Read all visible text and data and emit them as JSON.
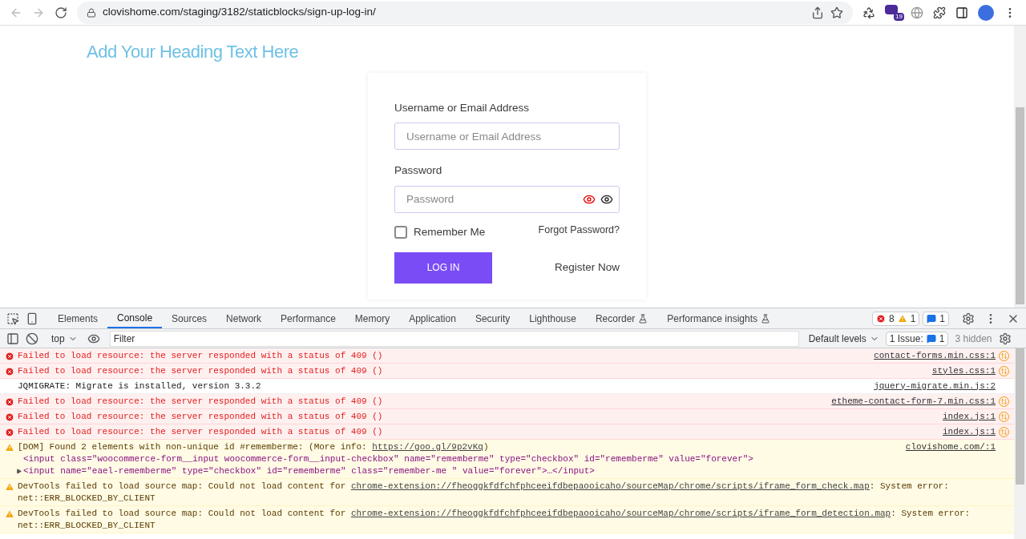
{
  "browser": {
    "url": "clovishome.com/staging/3182/staticblocks/sign-up-log-in/",
    "extension_badge": "19"
  },
  "page": {
    "heading": "Add Your Heading Text Here",
    "form": {
      "username_label": "Username or Email Address",
      "username_placeholder": "Username or Email Address",
      "password_label": "Password",
      "password_placeholder": "Password",
      "remember_label": "Remember Me",
      "remember_checked": false,
      "forgot_link": "Forgot Password?",
      "login_button": "LOG IN",
      "register_link": "Register Now"
    }
  },
  "devtools": {
    "tabs": [
      {
        "label": "Elements",
        "selected": false,
        "experimental": false
      },
      {
        "label": "Console",
        "selected": true,
        "experimental": false
      },
      {
        "label": "Sources",
        "selected": false,
        "experimental": false
      },
      {
        "label": "Network",
        "selected": false,
        "experimental": false
      },
      {
        "label": "Performance",
        "selected": false,
        "experimental": false
      },
      {
        "label": "Memory",
        "selected": false,
        "experimental": false
      },
      {
        "label": "Application",
        "selected": false,
        "experimental": false
      },
      {
        "label": "Security",
        "selected": false,
        "experimental": false
      },
      {
        "label": "Lighthouse",
        "selected": false,
        "experimental": false
      },
      {
        "label": "Recorder",
        "selected": false,
        "experimental": true
      },
      {
        "label": "Performance insights",
        "selected": false,
        "experimental": true
      }
    ],
    "error_count": "8",
    "warning_count": "1",
    "issue_count": "1",
    "context": "top",
    "filter_placeholder": "Filter",
    "levels": "Default levels",
    "issues_label": "1 Issue:",
    "issues_count": "1",
    "hidden": "3 hidden",
    "messages": [
      {
        "kind": "error",
        "text": "Failed to load resource: the server responded with a status of 409 ()",
        "source": "contact-forms.min.css:1"
      },
      {
        "kind": "error",
        "text": "Failed to load resource: the server responded with a status of 409 ()",
        "source": "styles.css:1"
      },
      {
        "kind": "info",
        "text": "JQMIGRATE: Migrate is installed, version 3.3.2",
        "source": "jquery-migrate.min.js:2"
      },
      {
        "kind": "error",
        "text": "Failed to load resource: the server responded with a status of 409 ()",
        "source": "etheme-contact-form-7.min.css:1"
      },
      {
        "kind": "error",
        "text": "Failed to load resource: the server responded with a status of 409 ()",
        "source": "index.js:1"
      },
      {
        "kind": "error",
        "text": "Failed to load resource: the server responded with a status of 409 ()",
        "source": "index.js:1"
      },
      {
        "kind": "warning",
        "text": "[DOM] Found 2 elements with non-unique id #rememberme: (More info: ",
        "link": "https://goo.gl/9p2vKq",
        "after": ")",
        "source": "clovishome.com/:1",
        "code": [
          {
            "text": "<input class=\"woocommerce-form__input woocommerce-form__input-checkbox\" name=\"rememberme\" type=\"checkbox\" id=\"rememberme\" value=\"forever\">",
            "expandable": false
          },
          {
            "text": "<input name=\"eael-rememberme\" type=\"checkbox\" id=\"rememberme\" class=\"remember-me \" value=\"forever\">…</input>",
            "expandable": true
          }
        ]
      },
      {
        "kind": "warning",
        "text": "DevTools failed to load source map: Could not load content for ",
        "link": "chrome-extension://fheoggkfdfchfphceeifdbepaooicaho/sourceMap/chrome/scripts/iframe_form_check.map",
        "after": ": System error:",
        "second_line": "net::ERR_BLOCKED_BY_CLIENT"
      },
      {
        "kind": "warning",
        "text": "DevTools failed to load source map: Could not load content for ",
        "link": "chrome-extension://fheoggkfdfchfphceeifdbepaooicaho/sourceMap/chrome/scripts/iframe_form_detection.map",
        "after": ": System error:",
        "second_line": "net::ERR_BLOCKED_BY_CLIENT"
      }
    ]
  }
}
